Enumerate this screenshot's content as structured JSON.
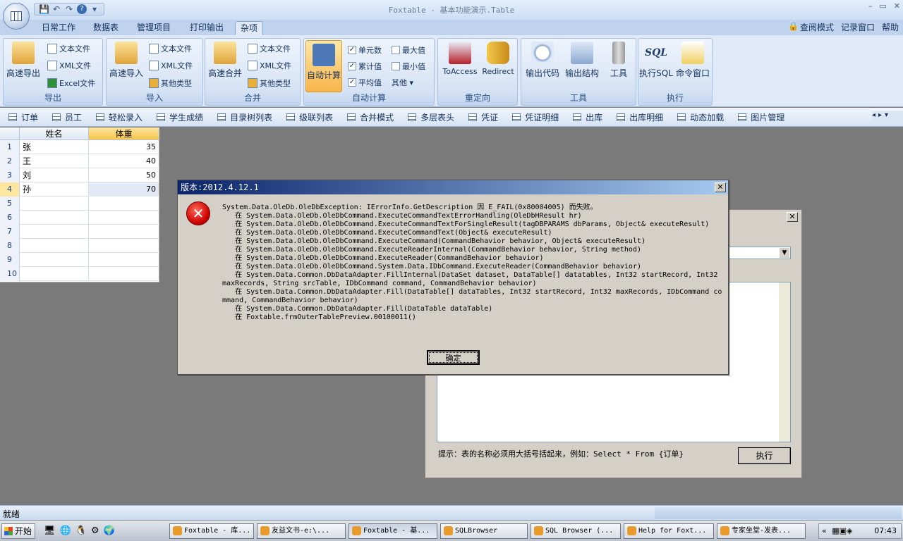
{
  "window": {
    "title": "Foxtable - 基本功能演示.Table"
  },
  "qat": {
    "save": "💾",
    "undo": "↶",
    "redo": "↷",
    "help": "?",
    "more": "▾"
  },
  "winctrl": {
    "min": "–",
    "max": "▭",
    "close": "✕"
  },
  "tabs": [
    "日常工作",
    "数据表",
    "管理项目",
    "打印输出",
    "杂项"
  ],
  "right_tools": {
    "read_mode": "查阅模式",
    "log_window": "记录窗口",
    "help": "帮助"
  },
  "ribbon": {
    "export": {
      "label": "导出",
      "big": "高速导出",
      "items": [
        "文本文件",
        "XML文件",
        "Excel文件"
      ]
    },
    "import": {
      "label": "导入",
      "big": "高速导入",
      "items": [
        "文本文件",
        "XML文件",
        "其他类型"
      ]
    },
    "merge": {
      "label": "合并",
      "big": "高速合并",
      "items": [
        "文本文件",
        "XML文件",
        "其他类型"
      ]
    },
    "autocalc": {
      "label": "自动计算",
      "big": "自动计算",
      "checks": [
        "单元数",
        "累计值",
        "平均值"
      ],
      "checks2": [
        "最大值",
        "最小值"
      ],
      "other": "其他 ▾"
    },
    "redirect": {
      "label": "重定向",
      "b1": "ToAccess",
      "b2": "Redirect"
    },
    "tools": {
      "label": "工具",
      "b1": "输出代码",
      "b2": "输出结构",
      "b3": "工具"
    },
    "exec": {
      "label": "执行",
      "b1": "执行SQL",
      "b2": "命令窗口",
      "sql_logo": "SQL"
    }
  },
  "nav": [
    "订单",
    "员工",
    "轻松录入",
    "学生成绩",
    "目录树列表",
    "级联列表",
    "合并模式",
    "多层表头",
    "凭证",
    "凭证明细",
    "出库",
    "出库明细",
    "动态加载",
    "图片管理"
  ],
  "grid": {
    "headers": [
      "姓名",
      "体重"
    ],
    "rows": [
      {
        "n": "1",
        "name": "张",
        "w": "35"
      },
      {
        "n": "2",
        "name": "王",
        "w": "40"
      },
      {
        "n": "3",
        "name": "刘",
        "w": "50"
      },
      {
        "n": "4",
        "name": "孙",
        "w": "70"
      },
      {
        "n": "5",
        "name": "",
        "w": ""
      },
      {
        "n": "6",
        "name": "",
        "w": ""
      },
      {
        "n": "7",
        "name": "",
        "w": ""
      },
      {
        "n": "8",
        "name": "",
        "w": ""
      },
      {
        "n": "9",
        "name": "",
        "w": ""
      },
      {
        "n": "10",
        "name": "",
        "w": ""
      }
    ]
  },
  "sqlbrowser": {
    "hint": "提示：表的名称必须用大括号括起来，例如：Select * From {订单}",
    "run": "执行"
  },
  "error": {
    "title": "版本:2012.4.12.1",
    "message": "System.Data.OleDb.OleDbException: IErrorInfo.GetDescription 因 E_FAIL(0x80004005) 而失败。\n   在 System.Data.OleDb.OleDbCommand.ExecuteCommandTextErrorHandling(OleDbHResult hr)\n   在 System.Data.OleDb.OleDbCommand.ExecuteCommandTextForSingleResult(tagDBPARAMS dbParams, Object& executeResult)\n   在 System.Data.OleDb.OleDbCommand.ExecuteCommandText(Object& executeResult)\n   在 System.Data.OleDb.OleDbCommand.ExecuteCommand(CommandBehavior behavior, Object& executeResult)\n   在 System.Data.OleDb.OleDbCommand.ExecuteReaderInternal(CommandBehavior behavior, String method)\n   在 System.Data.OleDb.OleDbCommand.ExecuteReader(CommandBehavior behavior)\n   在 System.Data.OleDb.OleDbCommand.System.Data.IDbCommand.ExecuteReader(CommandBehavior behavior)\n   在 System.Data.Common.DbDataAdapter.FillInternal(DataSet dataset, DataTable[] datatables, Int32 startRecord, Int32 maxRecords, String srcTable, IDbCommand command, CommandBehavior behavior)\n   在 System.Data.Common.DbDataAdapter.Fill(DataTable[] dataTables, Int32 startRecord, Int32 maxRecords, IDbCommand command, CommandBehavior behavior)\n   在 System.Data.Common.DbDataAdapter.Fill(DataTable dataTable)\n   在 Foxtable.frmOuterTablePreview.00100011()",
    "ok": "确定"
  },
  "status": {
    "text": "就绪"
  },
  "taskbar": {
    "start": "开始",
    "items": [
      "Foxtable - 库...",
      "友益文书-e:\\...",
      "Foxtable - 基...",
      "SQLBrowser",
      "SQL Browser (...",
      "Help for Foxt...",
      "专家坐堂-发表..."
    ],
    "time": "07:43"
  }
}
